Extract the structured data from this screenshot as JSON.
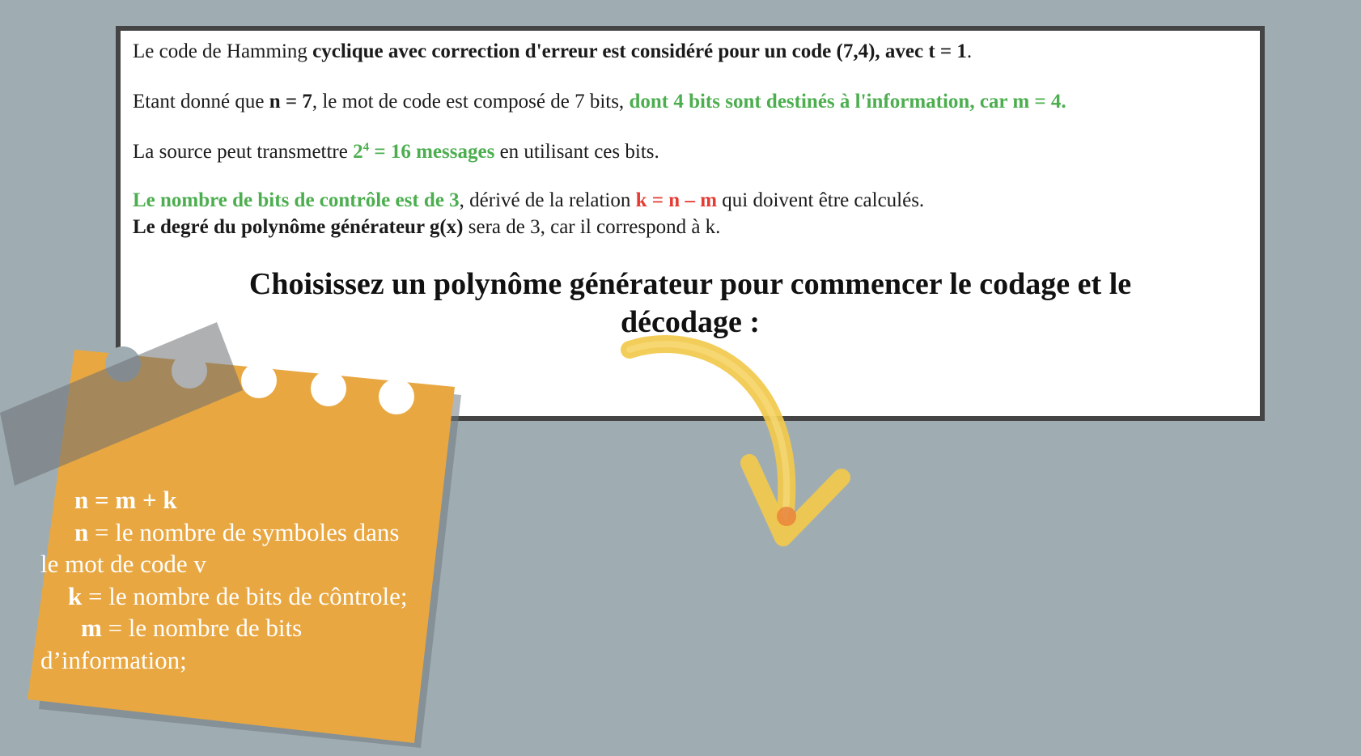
{
  "panel": {
    "line1": {
      "a": "Le code de Hamming ",
      "b": "cyclique avec correction d'erreur est considéré pour un code (7,4), avec t = 1",
      "c": "."
    },
    "line2": {
      "a": "Etant donné que ",
      "b": "n = 7",
      "c": ", le mot de code est composé de 7 bits, ",
      "d": "dont 4 bits sont destinés à l'information, car m = 4."
    },
    "line3": {
      "a": "La source peut transmettre ",
      "b_base": "2",
      "b_sup": "4",
      "b_rest": " = 16 messages",
      "c": " en utilisant ces bits."
    },
    "line4": {
      "a": "Le nombre de bits de contrôle est de 3",
      "b": ", dérivé de la relation ",
      "c": "k = n – m",
      "d": " qui doivent être calculés."
    },
    "line5": {
      "a": "Le degré du polynôme générateur g(x)",
      "b": " sera de 3, car il correspond à k."
    },
    "heading_line1": "Choisissez un polynôme générateur pour commencer le codage et le",
    "heading_line2": "décodage :"
  },
  "note": {
    "l1": "n = m + k",
    "l2_bold": "n",
    "l2_rest": " = le nombre de symboles dans",
    "l3": "le mot de code v",
    "l4_bold": "k",
    "l4_rest": " = le nombre de bits de côntrole;",
    "l5_bold": "m",
    "l5_rest": " = le nombre de bits",
    "l6": "d’information;"
  },
  "colors": {
    "background": "#9fadb3",
    "panel_border": "#444444",
    "green": "#4cae4f",
    "red": "#e53b32",
    "note": "#e8a741",
    "arrow": "#f2c94c"
  },
  "icons": {
    "arrow": "curved-arrow-icon",
    "tape": "tape-strip",
    "note": "sticky-note"
  }
}
